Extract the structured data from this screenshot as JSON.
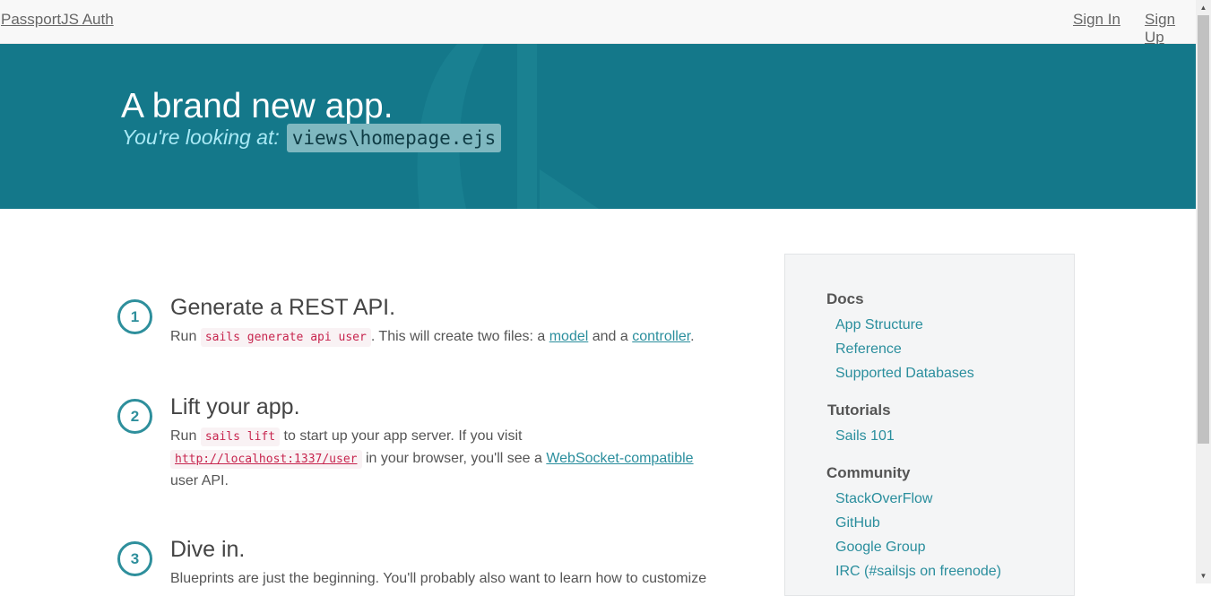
{
  "nav": {
    "brand": "PassportJS Auth",
    "sign_in": "Sign In",
    "sign_up": "Sign Up"
  },
  "hero": {
    "title": "A brand new app.",
    "subtitle": "You're looking at:",
    "file": "views\\homepage.ejs"
  },
  "steps": [
    {
      "number": "1",
      "title": "Generate a REST API.",
      "p1": "Run",
      "code": "sails generate api user",
      "p2": ". This will create two files: a",
      "link1": "model",
      "p3": "and a",
      "link2": "controller",
      "p4": "."
    },
    {
      "number": "2",
      "title": "Lift your app.",
      "p1": "Run",
      "code": "sails lift",
      "p2": "to start up your app server. If you visit",
      "url": "http://localhost:1337/user",
      "p3": "in your browser, you'll see a",
      "link1": "WebSocket-compatible",
      "p4": "user API."
    },
    {
      "number": "3",
      "title": "Dive in.",
      "text": "Blueprints are just the beginning. You'll probably also want to learn how to customize"
    }
  ],
  "sidebar": {
    "docs": {
      "heading": "Docs",
      "links": [
        "App Structure",
        "Reference",
        "Supported Databases"
      ]
    },
    "tutorials": {
      "heading": "Tutorials",
      "links": [
        "Sails 101"
      ]
    },
    "community": {
      "heading": "Community",
      "links": [
        "StackOverFlow",
        "GitHub",
        "Google Group",
        "IRC (#sailsjs on freenode)"
      ]
    }
  },
  "colors": {
    "hero_bg": "#14788a",
    "accent": "#2a8e9d",
    "code_text": "#c7254e"
  }
}
